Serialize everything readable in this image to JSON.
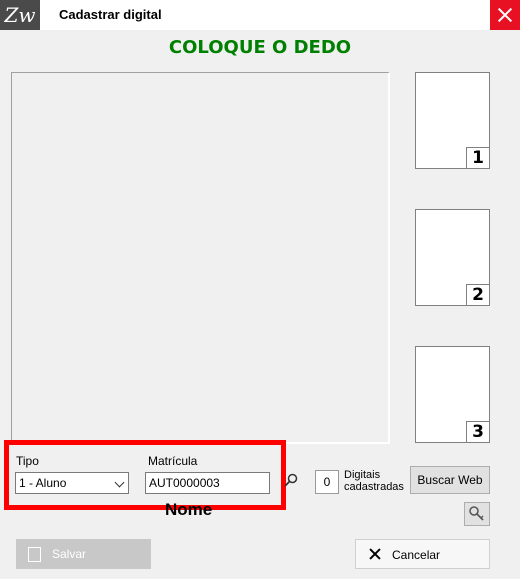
{
  "window": {
    "title": "Cadastrar digital",
    "logo_text": "Zw"
  },
  "instruction": "COLOQUE O DEDO",
  "thumbnails": [
    "1",
    "2",
    "3"
  ],
  "form": {
    "tipo_label": "Tipo",
    "tipo_value": "1 - Aluno",
    "matricula_label": "Matrícula",
    "matricula_value": "AUT0000003",
    "digitais_count": "0",
    "digitais_label_line1": "Digitais",
    "digitais_label_line2": "cadastradas",
    "buscar_web_label": "Buscar Web",
    "nome_label": "Nome"
  },
  "actions": {
    "salvar_label": "Salvar",
    "cancelar_label": "Cancelar"
  },
  "colors": {
    "close": "#e81123",
    "instruction": "#008000",
    "highlight": "#ff0000"
  },
  "icons": [
    "app-logo-icon",
    "close-icon",
    "search-icon",
    "key-icon",
    "save-icon",
    "cancel-icon"
  ]
}
